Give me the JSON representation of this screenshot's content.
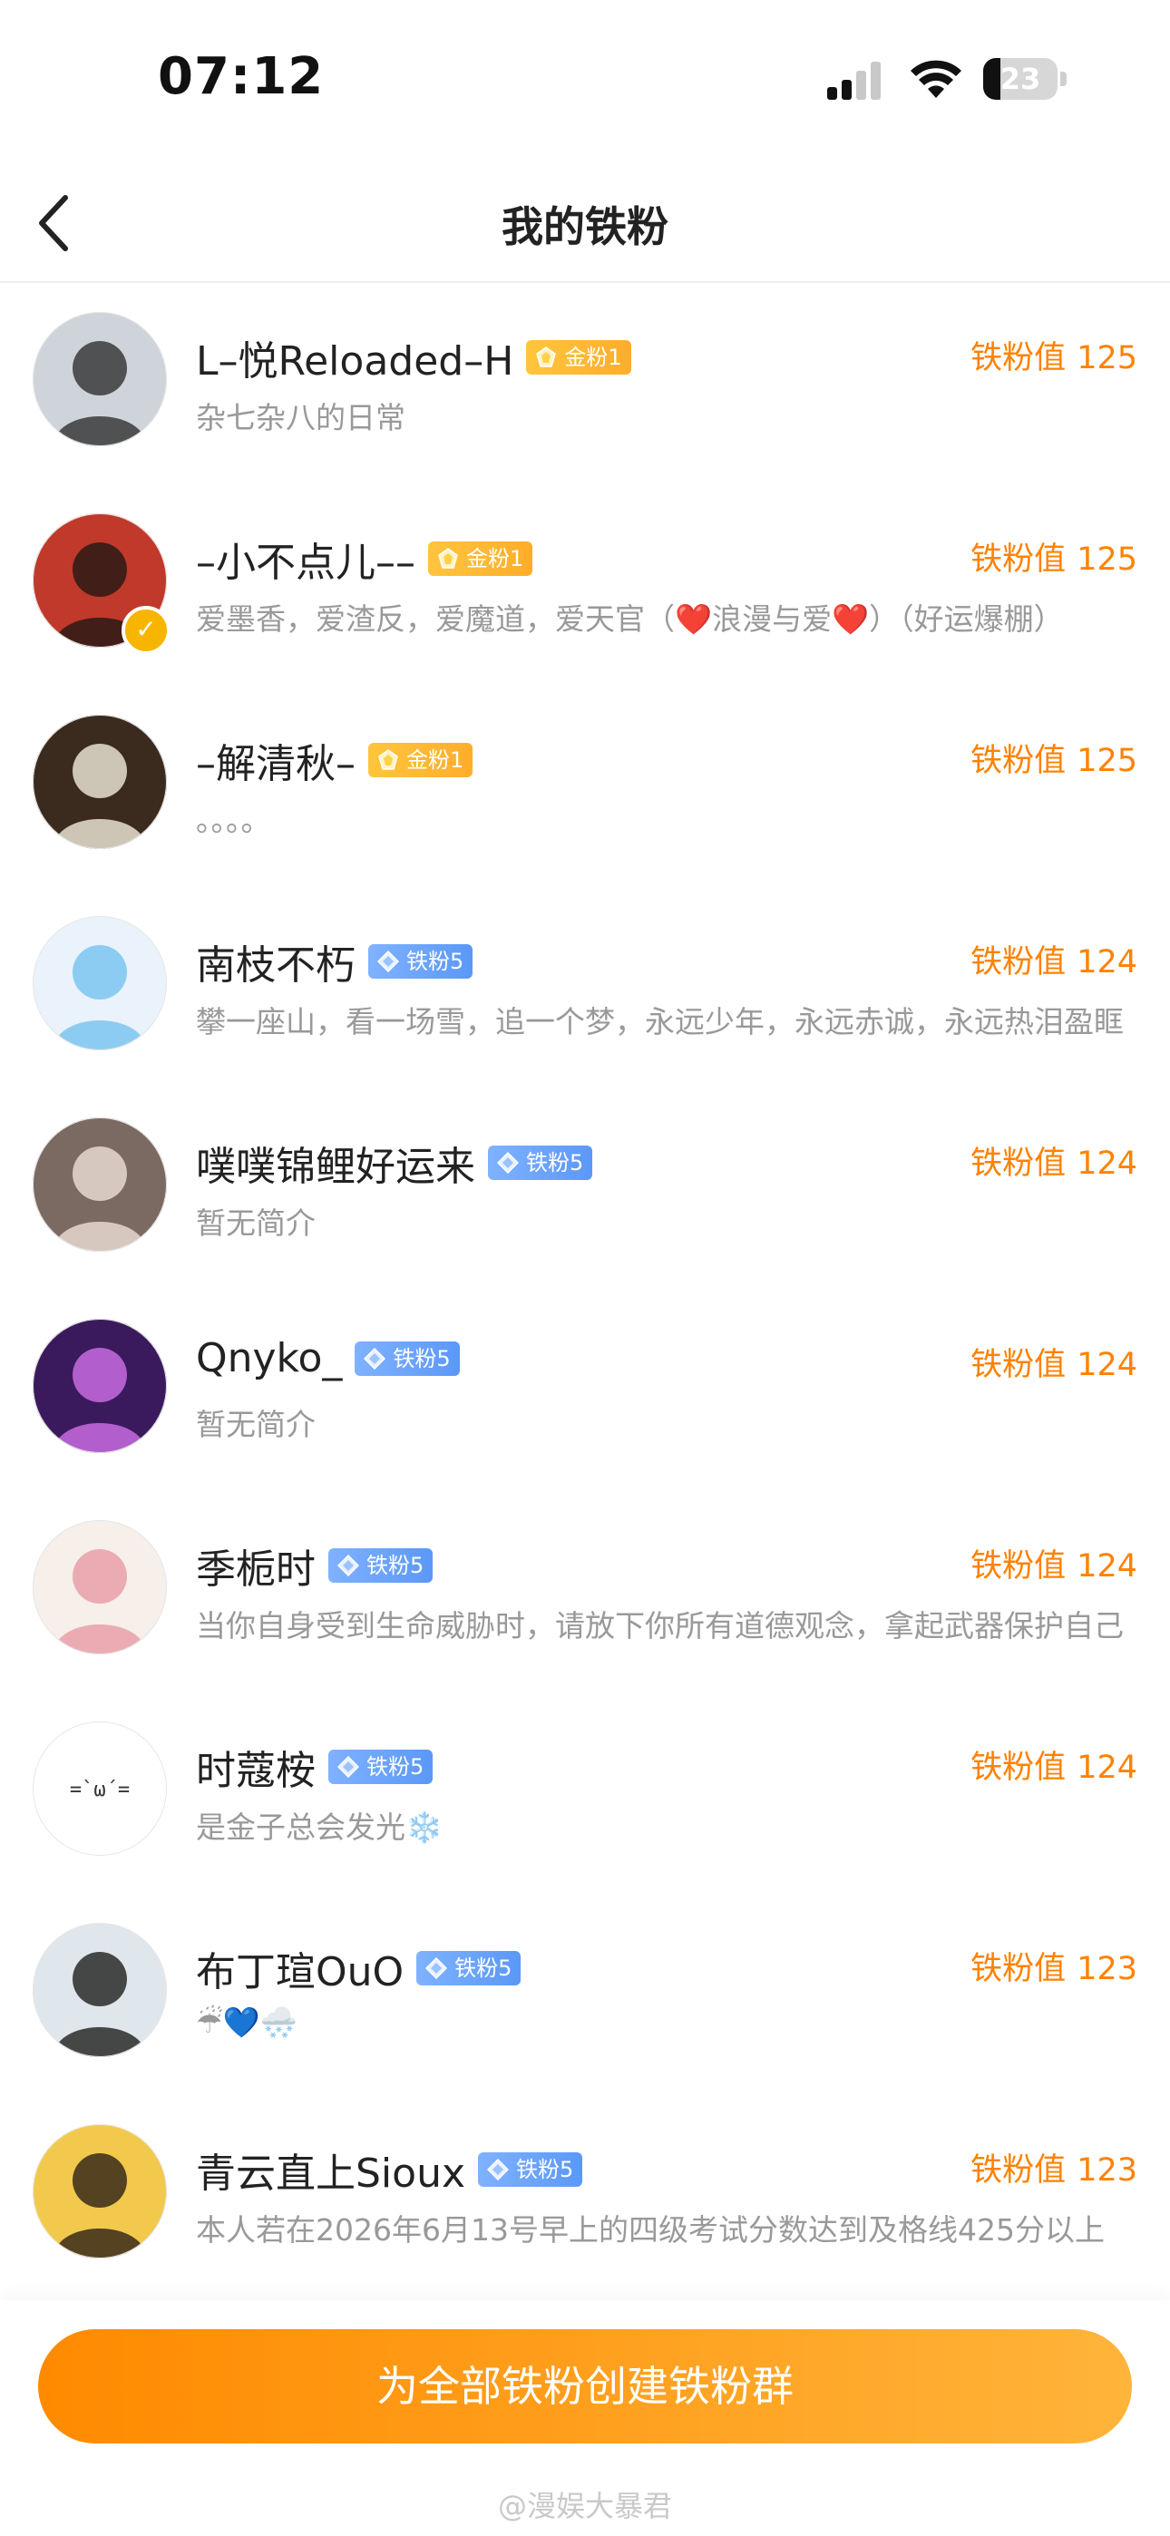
{
  "status_bar": {
    "time": "07:12",
    "battery": "23",
    "battery_level": 0.23
  },
  "nav": {
    "title": "我的铁粉"
  },
  "fan_value_label": "铁粉值",
  "fans": [
    {
      "name": "L–悦Reloaded–H",
      "badge": "金粉1",
      "badge_type": "gold",
      "bio": "杂七杂八的日常",
      "value": "125",
      "verified": false,
      "avatar": {
        "bg": "#cfd4da",
        "fg": "#3a3a3a"
      }
    },
    {
      "name": "–小不点儿––",
      "badge": "金粉1",
      "badge_type": "gold",
      "bio": "爱墨香，爱渣反，爱魔道，爱天官（❤️浪漫与爱❤️）（好运爆棚）",
      "value": "125",
      "verified": true,
      "avatar": {
        "bg": "#c0392b",
        "fg": "#2b1a16"
      }
    },
    {
      "name": "–解清秋–",
      "badge": "金粉1",
      "badge_type": "gold",
      "bio": "。。。。",
      "value": "125",
      "verified": false,
      "avatar": {
        "bg": "#3b2a1e",
        "fg": "#e8e0d0"
      }
    },
    {
      "name": "南枝不朽",
      "badge": "铁粉5",
      "badge_type": "iron",
      "bio": "攀一座山，看一场雪，追一个梦，永远少年，永远赤诚，永远热泪盈眶",
      "value": "124",
      "verified": false,
      "avatar": {
        "bg": "#eaf3fb",
        "fg": "#7cc4f0"
      }
    },
    {
      "name": "噗噗锦鲤好运来",
      "badge": "铁粉5",
      "badge_type": "iron",
      "bio": "暂无简介",
      "value": "124",
      "verified": false,
      "avatar": {
        "bg": "#7a6a62",
        "fg": "#e8d8d0"
      }
    },
    {
      "name": "Qnyko_",
      "badge": "铁粉5",
      "badge_type": "iron",
      "bio": "暂无简介",
      "value": "124",
      "verified": false,
      "avatar": {
        "bg": "#3a1a5c",
        "fg": "#c86be0"
      }
    },
    {
      "name": "季栀时",
      "badge": "铁粉5",
      "badge_type": "iron",
      "bio": "当你自身受到生命威胁时，请放下你所有道德观念，拿起武器保护自己",
      "value": "124",
      "verified": false,
      "avatar": {
        "bg": "#f6efea",
        "fg": "#e8a0a8"
      }
    },
    {
      "name": "时蔻桉",
      "badge": "铁粉5",
      "badge_type": "iron",
      "bio": "是金子总会发光❄️",
      "value": "124",
      "verified": false,
      "avatar": {
        "bg": "#ffffff",
        "fg": "#333333",
        "text": "=`ω´="
      }
    },
    {
      "name": "布丁瑄OuO",
      "badge": "铁粉5",
      "badge_type": "iron",
      "bio": "☔💙🌨️",
      "value": "123",
      "verified": false,
      "avatar": {
        "bg": "#dfe6ec",
        "fg": "#2a2a2a"
      }
    },
    {
      "name": "青云直上Sioux",
      "badge": "铁粉5",
      "badge_type": "iron",
      "bio": "本人若在2026年6月13号早上的四级考试分数达到及格线425分以上",
      "value": "123",
      "verified": false,
      "avatar": {
        "bg": "#f2c94c",
        "fg": "#3a2a1a"
      }
    }
  ],
  "footer": {
    "create_button": "为全部铁粉创建铁粉群",
    "watermark": "@漫娱大暴君"
  },
  "colors": {
    "accent": "#ff8200",
    "gold_badge": "#ffb52e",
    "iron_badge": "#6aa3f8",
    "button_start": "#ff8a00",
    "button_end": "#ffb43a"
  }
}
